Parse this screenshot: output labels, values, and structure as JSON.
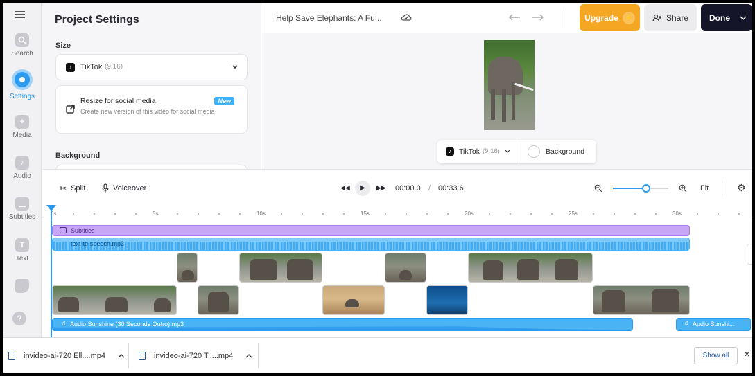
{
  "rail": {
    "items": [
      {
        "label": "Search",
        "icon": "search-icon"
      },
      {
        "label": "Settings",
        "icon": "settings-icon"
      },
      {
        "label": "Media",
        "icon": "media-icon"
      },
      {
        "label": "Audio",
        "icon": "audio-icon"
      },
      {
        "label": "Subtitles",
        "icon": "subtitles-icon"
      },
      {
        "label": "Text",
        "icon": "text-icon"
      }
    ],
    "help": "?"
  },
  "panel": {
    "title": "Project Settings",
    "size_label": "Size",
    "size_value": "TikTok",
    "size_ratio": "(9:16)",
    "resize_title": "Resize for social media",
    "resize_badge": "New",
    "resize_desc": "Create new version of this video for social media",
    "background_label": "Background"
  },
  "topbar": {
    "project_title": "Help Save Elephants: A Fu...",
    "upgrade": "Upgrade",
    "share": "Share",
    "done": "Done"
  },
  "preview": {
    "format_name": "TikTok",
    "format_ratio": "(9:16)",
    "background": "Background"
  },
  "toolbar": {
    "split": "Split",
    "voiceover": "Voiceover",
    "current_time": "00:00.0",
    "separator": "/",
    "total_time": "00:33.6",
    "zoom_level": 0.6,
    "fit": "Fit"
  },
  "ruler": {
    "ticks": [
      "0s",
      "5s",
      "10s",
      "15s",
      "20s",
      "25s",
      "30s"
    ]
  },
  "tracks": {
    "subtitles": "Subtitles",
    "tts": "text-to-speech.mp3",
    "audio1": "Audio Sunshine (30 Seconds Outro).mp3",
    "audio2": "Audio Sunshi..."
  },
  "downloads": {
    "file1": "invideo-ai-720 Ell....mp4",
    "file2": "invideo-ai-720 Ti....mp4",
    "show_all": "Show all"
  },
  "colors": {
    "accent": "#2d9cf0",
    "upgrade": "#f5a623",
    "done": "#15152a",
    "subtitle_track": "#c7a6f5",
    "audio_track": "#4ab3f4"
  }
}
